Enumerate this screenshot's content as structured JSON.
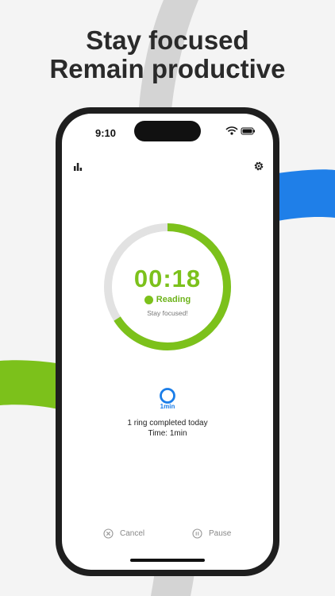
{
  "headline": {
    "line1": "Stay focused",
    "line2": "Remain productive"
  },
  "status_bar": {
    "time": "9:10"
  },
  "toolbar": {
    "stats_icon": "bar-chart-icon",
    "settings_icon": "gear-icon"
  },
  "timer": {
    "display": "00:18",
    "task_label": "Reading",
    "motto": "Stay focused!",
    "progress_fraction": 0.66
  },
  "rings": {
    "item_label": "1min",
    "summary_line1": "1 ring completed today",
    "summary_line2": "Time: 1min"
  },
  "controls": {
    "cancel_label": "Cancel",
    "pause_label": "Pause"
  },
  "colors": {
    "accent_green": "#7cc11b",
    "accent_blue": "#1a7de8",
    "track_gray": "#e2e2e2"
  }
}
